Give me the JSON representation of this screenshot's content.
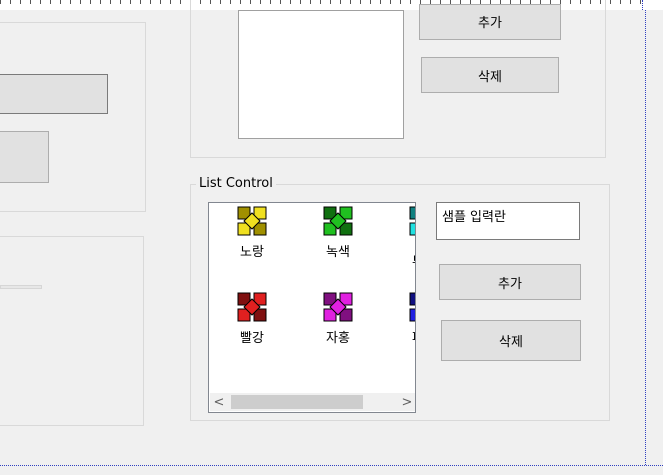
{
  "colors": {
    "accent_dotted": "#3040c0",
    "button_face": "#e1e1e1"
  },
  "upper_group": {
    "add_button_label": "추가",
    "delete_button_label": "삭제"
  },
  "list_group": {
    "title": "List Control",
    "items": [
      {
        "label": "노랑",
        "icon": "yellow-flower-icon",
        "color": "#f0e020",
        "dark": "#a09000"
      },
      {
        "label": "녹색",
        "icon": "green-flower-icon",
        "color": "#20c020",
        "dark": "#107010"
      },
      {
        "label": "",
        "icon": "cyan-flower-icon",
        "color": "#20e0e0",
        "dark": "#108080"
      },
      {
        "label": "빨강",
        "icon": "red-flower-icon",
        "color": "#e02020",
        "dark": "#801010"
      },
      {
        "label": "자홍",
        "icon": "magenta-flower-icon",
        "color": "#e020e0",
        "dark": "#801080"
      },
      {
        "label": "",
        "icon": "blue-flower-icon",
        "color": "#2020e0",
        "dark": "#101080"
      }
    ],
    "cut_labels": [
      "부",
      "파"
    ],
    "input_value": "샘플 입력란",
    "add_button_label": "추가",
    "delete_button_label": "삭제",
    "scroll_left": "<",
    "scroll_right": ">"
  }
}
